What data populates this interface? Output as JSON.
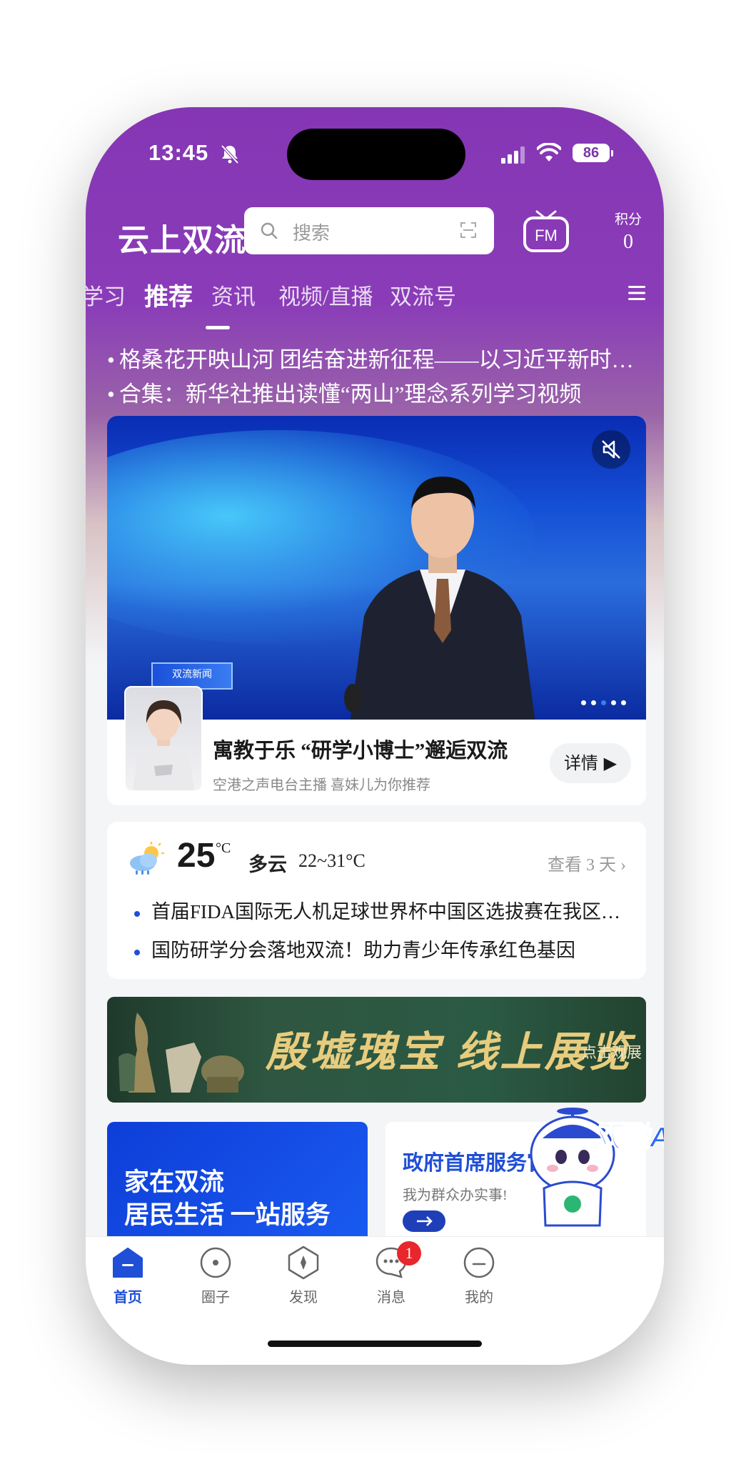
{
  "status_bar": {
    "time": "13:45",
    "battery": "86"
  },
  "header": {
    "app_title": "云上双流",
    "search_placeholder": "搜索",
    "points_label": "积分",
    "points_value": "0"
  },
  "tabs": [
    {
      "label": "学习"
    },
    {
      "label": "推荐"
    },
    {
      "label": "资讯"
    },
    {
      "label": "视频/直播"
    },
    {
      "label": "双流号"
    }
  ],
  "headlines": [
    "格桑花开映山河 团结奋进新征程——以习近平新时代中国特色社会主义思想为指导",
    "合集：新华社推出读懂“两山”理念系列学习视频"
  ],
  "featured": {
    "station_logo": "双流新闻",
    "title": "寓教于乐 “研学小博士”邂逅双流",
    "subtitle": "空港之声电台主播  喜妹儿为你推荐",
    "detail_button": "详情",
    "carousel_active_index": 2
  },
  "weather": {
    "temperature": "25",
    "unit": "°C",
    "condition": "多云",
    "range": "22~31°C",
    "forecast_link": "查看 3 天",
    "news": [
      "首届FIDA国际无人机足球世界杯中国区选拔赛在我区举行",
      "国防研学分会落地双流！助力青少年传承红色基因"
    ]
  },
  "banner": {
    "title": "殷墟瑰宝 线上展览",
    "cta": "点击观展"
  },
  "tiles": {
    "left": {
      "line1": "家在双流",
      "line2": "居民生活 一站服务"
    },
    "right": {
      "title": "政府首席服务官",
      "subtitle": "我为群众办实事!"
    }
  },
  "mascot": {
    "label": "双融AI"
  },
  "tabbar": [
    {
      "label": "首页",
      "active": true
    },
    {
      "label": "圈子"
    },
    {
      "label": "发现"
    },
    {
      "label": "消息",
      "badge": "1"
    },
    {
      "label": "我的"
    }
  ],
  "colors": {
    "header_purple": "#8536b4",
    "accent_blue": "#1f4fd6",
    "badge_red": "#e8262b"
  },
  "icons": [
    "bell-slash-icon",
    "signal-icon",
    "wifi-icon",
    "search-icon",
    "scan-icon",
    "fm-radio-icon",
    "menu-icon",
    "mute-icon",
    "play-triangle-icon",
    "cloud-sun-icon",
    "chevron-right-icon",
    "arrow-right-icon",
    "home-icon",
    "circle-icon",
    "compass-icon",
    "chat-icon",
    "smile-icon"
  ]
}
